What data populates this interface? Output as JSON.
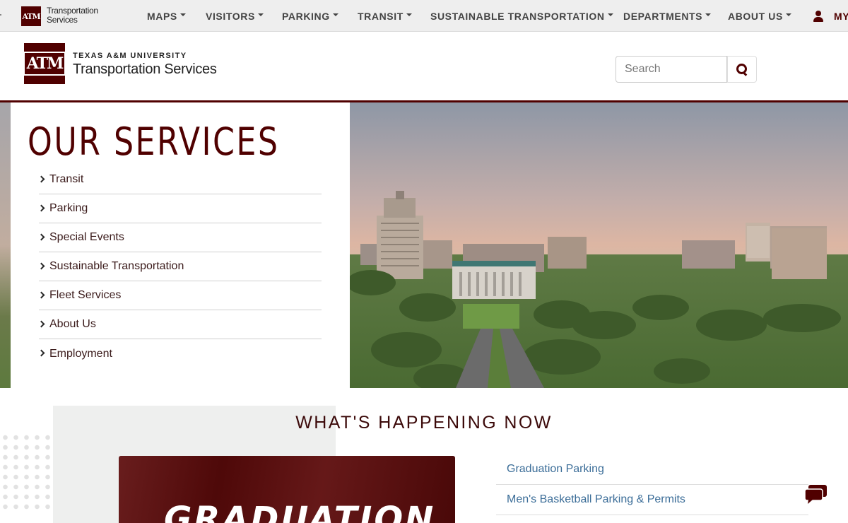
{
  "topnav": {
    "logo_text_line1": "Transportation",
    "logo_text_line2": "Services",
    "logo_mark": "ATM",
    "items": [
      {
        "label": "MAPS"
      },
      {
        "label": "VISITORS"
      },
      {
        "label": "PARKING"
      },
      {
        "label": "TRANSIT"
      },
      {
        "label": "SUSTAINABLE TRANSPORTATION"
      },
      {
        "label": "DEPARTMENTS"
      },
      {
        "label": "ABOUT US"
      }
    ],
    "my_label": "MY",
    "user_icon": "user-icon"
  },
  "header": {
    "logo_mark": "ATM",
    "university": "TEXAS A&M UNIVERSITY",
    "title": "Transportation Services",
    "search_placeholder": "Search",
    "search_icon": "search-icon"
  },
  "services": {
    "title": "OUR SERVICES",
    "items": [
      {
        "label": "Transit"
      },
      {
        "label": "Parking"
      },
      {
        "label": "Special Events"
      },
      {
        "label": "Sustainable Transportation"
      },
      {
        "label": "Fleet Services"
      },
      {
        "label": "About Us"
      },
      {
        "label": "Employment"
      }
    ]
  },
  "happening": {
    "title": "WHAT'S HAPPENING NOW",
    "featured_text": "GRADUATION",
    "news": [
      {
        "label": "Graduation Parking"
      },
      {
        "label": "Men's Basketball Parking & Permits"
      }
    ],
    "chat_icon": "chat-icon"
  },
  "colors": {
    "maroon": "#500000",
    "link_blue": "#3b6d98",
    "nav_gray": "#eeeeee"
  }
}
